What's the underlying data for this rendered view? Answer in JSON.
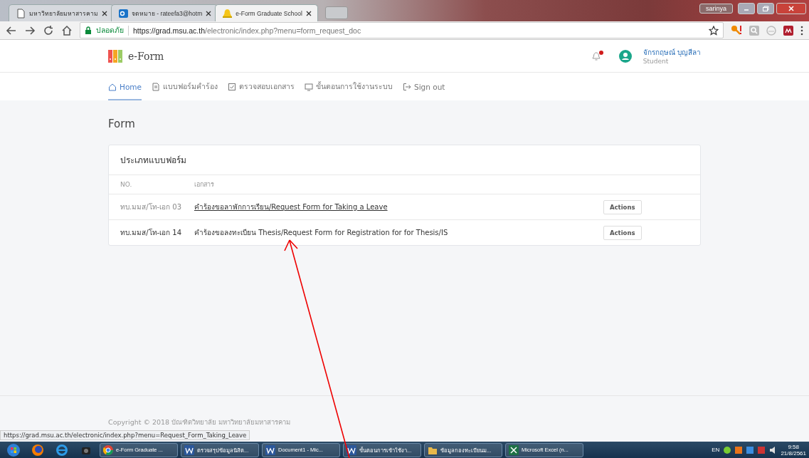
{
  "browser": {
    "tabs": [
      {
        "title": "มหาวิทยาลัยมหาสารคาม",
        "kind": "page",
        "selected": false
      },
      {
        "title": "จดหมาย - rateefa3@hotm",
        "kind": "mail",
        "selected": false
      },
      {
        "title": "e-Form Graduate School",
        "kind": "bell",
        "selected": true
      }
    ],
    "window_user": "sarinya",
    "secure_label": "ปลอดภัย",
    "url": {
      "host": "https://grad.msu.ac.th",
      "path": "/electronic/index.php?menu=form_request_doc"
    }
  },
  "app": {
    "logo_text": "e-Form",
    "notification": {
      "unread": true
    },
    "user": {
      "name": "จักรกฤษณ์ บุญสีลา",
      "role": "Student"
    },
    "nav": [
      {
        "label": "Home",
        "selected": true
      },
      {
        "label": "แบบฟอร์มคำร้อง",
        "selected": false
      },
      {
        "label": "ตรวจสอบเอกสาร",
        "selected": false
      },
      {
        "label": "ขั้นตอนการใช้งานระบบ",
        "selected": false
      },
      {
        "label": "Sign out",
        "selected": false
      }
    ],
    "page_title": "Form",
    "card_title": "ประเภทแบบฟอร์ม",
    "table": {
      "columns": [
        "NO.",
        "เอกสาร"
      ],
      "rows": [
        {
          "no": "ทบ.มมส/โท-เอก 03",
          "document": "คำร้องขอลาพักการเรียน/Request Form for Taking a Leave",
          "action": "Actions",
          "hovered": true
        },
        {
          "no": "ทบ.มมส/โท-เอก 14",
          "document": "คำร้องขอลงทะเบียน Thesis/Request Form for Registration for for Thesis/IS",
          "action": "Actions",
          "hovered": false
        }
      ]
    },
    "footer": "Copyright © 2018 บัณฑิตวิทยาลัย มหาวิทยาลัยมหาสารคาม"
  },
  "status_url": "https://grad.msu.ac.th/electronic/index.php?menu=Request_Form_Taking_Leave",
  "taskbar": {
    "items": [
      {
        "label": "e-Form Graduate ...",
        "kind": "chrome"
      },
      {
        "label": "ตรวจสรุปข้อมูลนิสิต...",
        "kind": "word"
      },
      {
        "label": "Document1 - Mic...",
        "kind": "word"
      },
      {
        "label": "ขั้นตอนการเข้าใช้งา...",
        "kind": "word"
      },
      {
        "label": "ข้อมูลกองทะเบียนม...",
        "kind": "folder"
      },
      {
        "label": "Microsoft Excel (n...",
        "kind": "excel"
      }
    ],
    "language": "EN",
    "time": "9:58",
    "date": "21/8/2561"
  }
}
